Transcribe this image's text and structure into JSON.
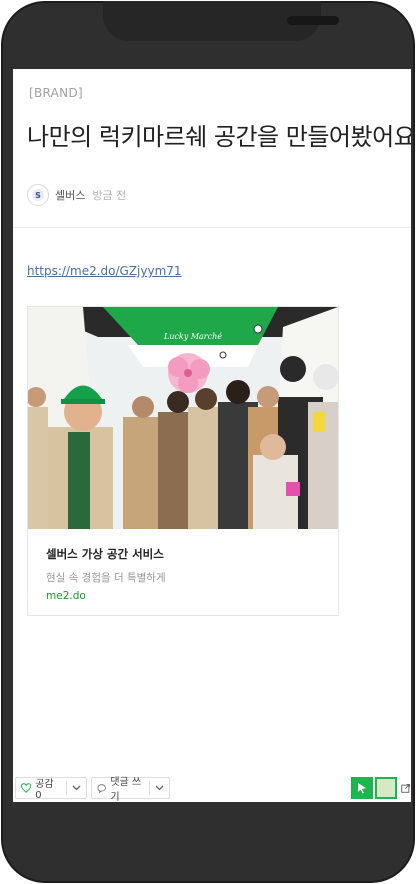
{
  "post": {
    "category": "[BRAND]",
    "title": "나만의 럭키마르쉐 공간을 만들어봤어요-",
    "author": "셀버스",
    "time": "방금 전",
    "link": "https://me2.do/GZjyym71"
  },
  "card": {
    "title": "셀버스 가상 공간 서비스",
    "description": "현실 속 경험을 더 특별하게",
    "domain": "me2.do",
    "sign_text": "Lucky Marché"
  },
  "actions": {
    "like_label": "공감 0",
    "comment_label": "댓글 쓰기"
  },
  "colors": {
    "accent_green": "#1db54d",
    "link_blue": "#4a6fa5"
  }
}
